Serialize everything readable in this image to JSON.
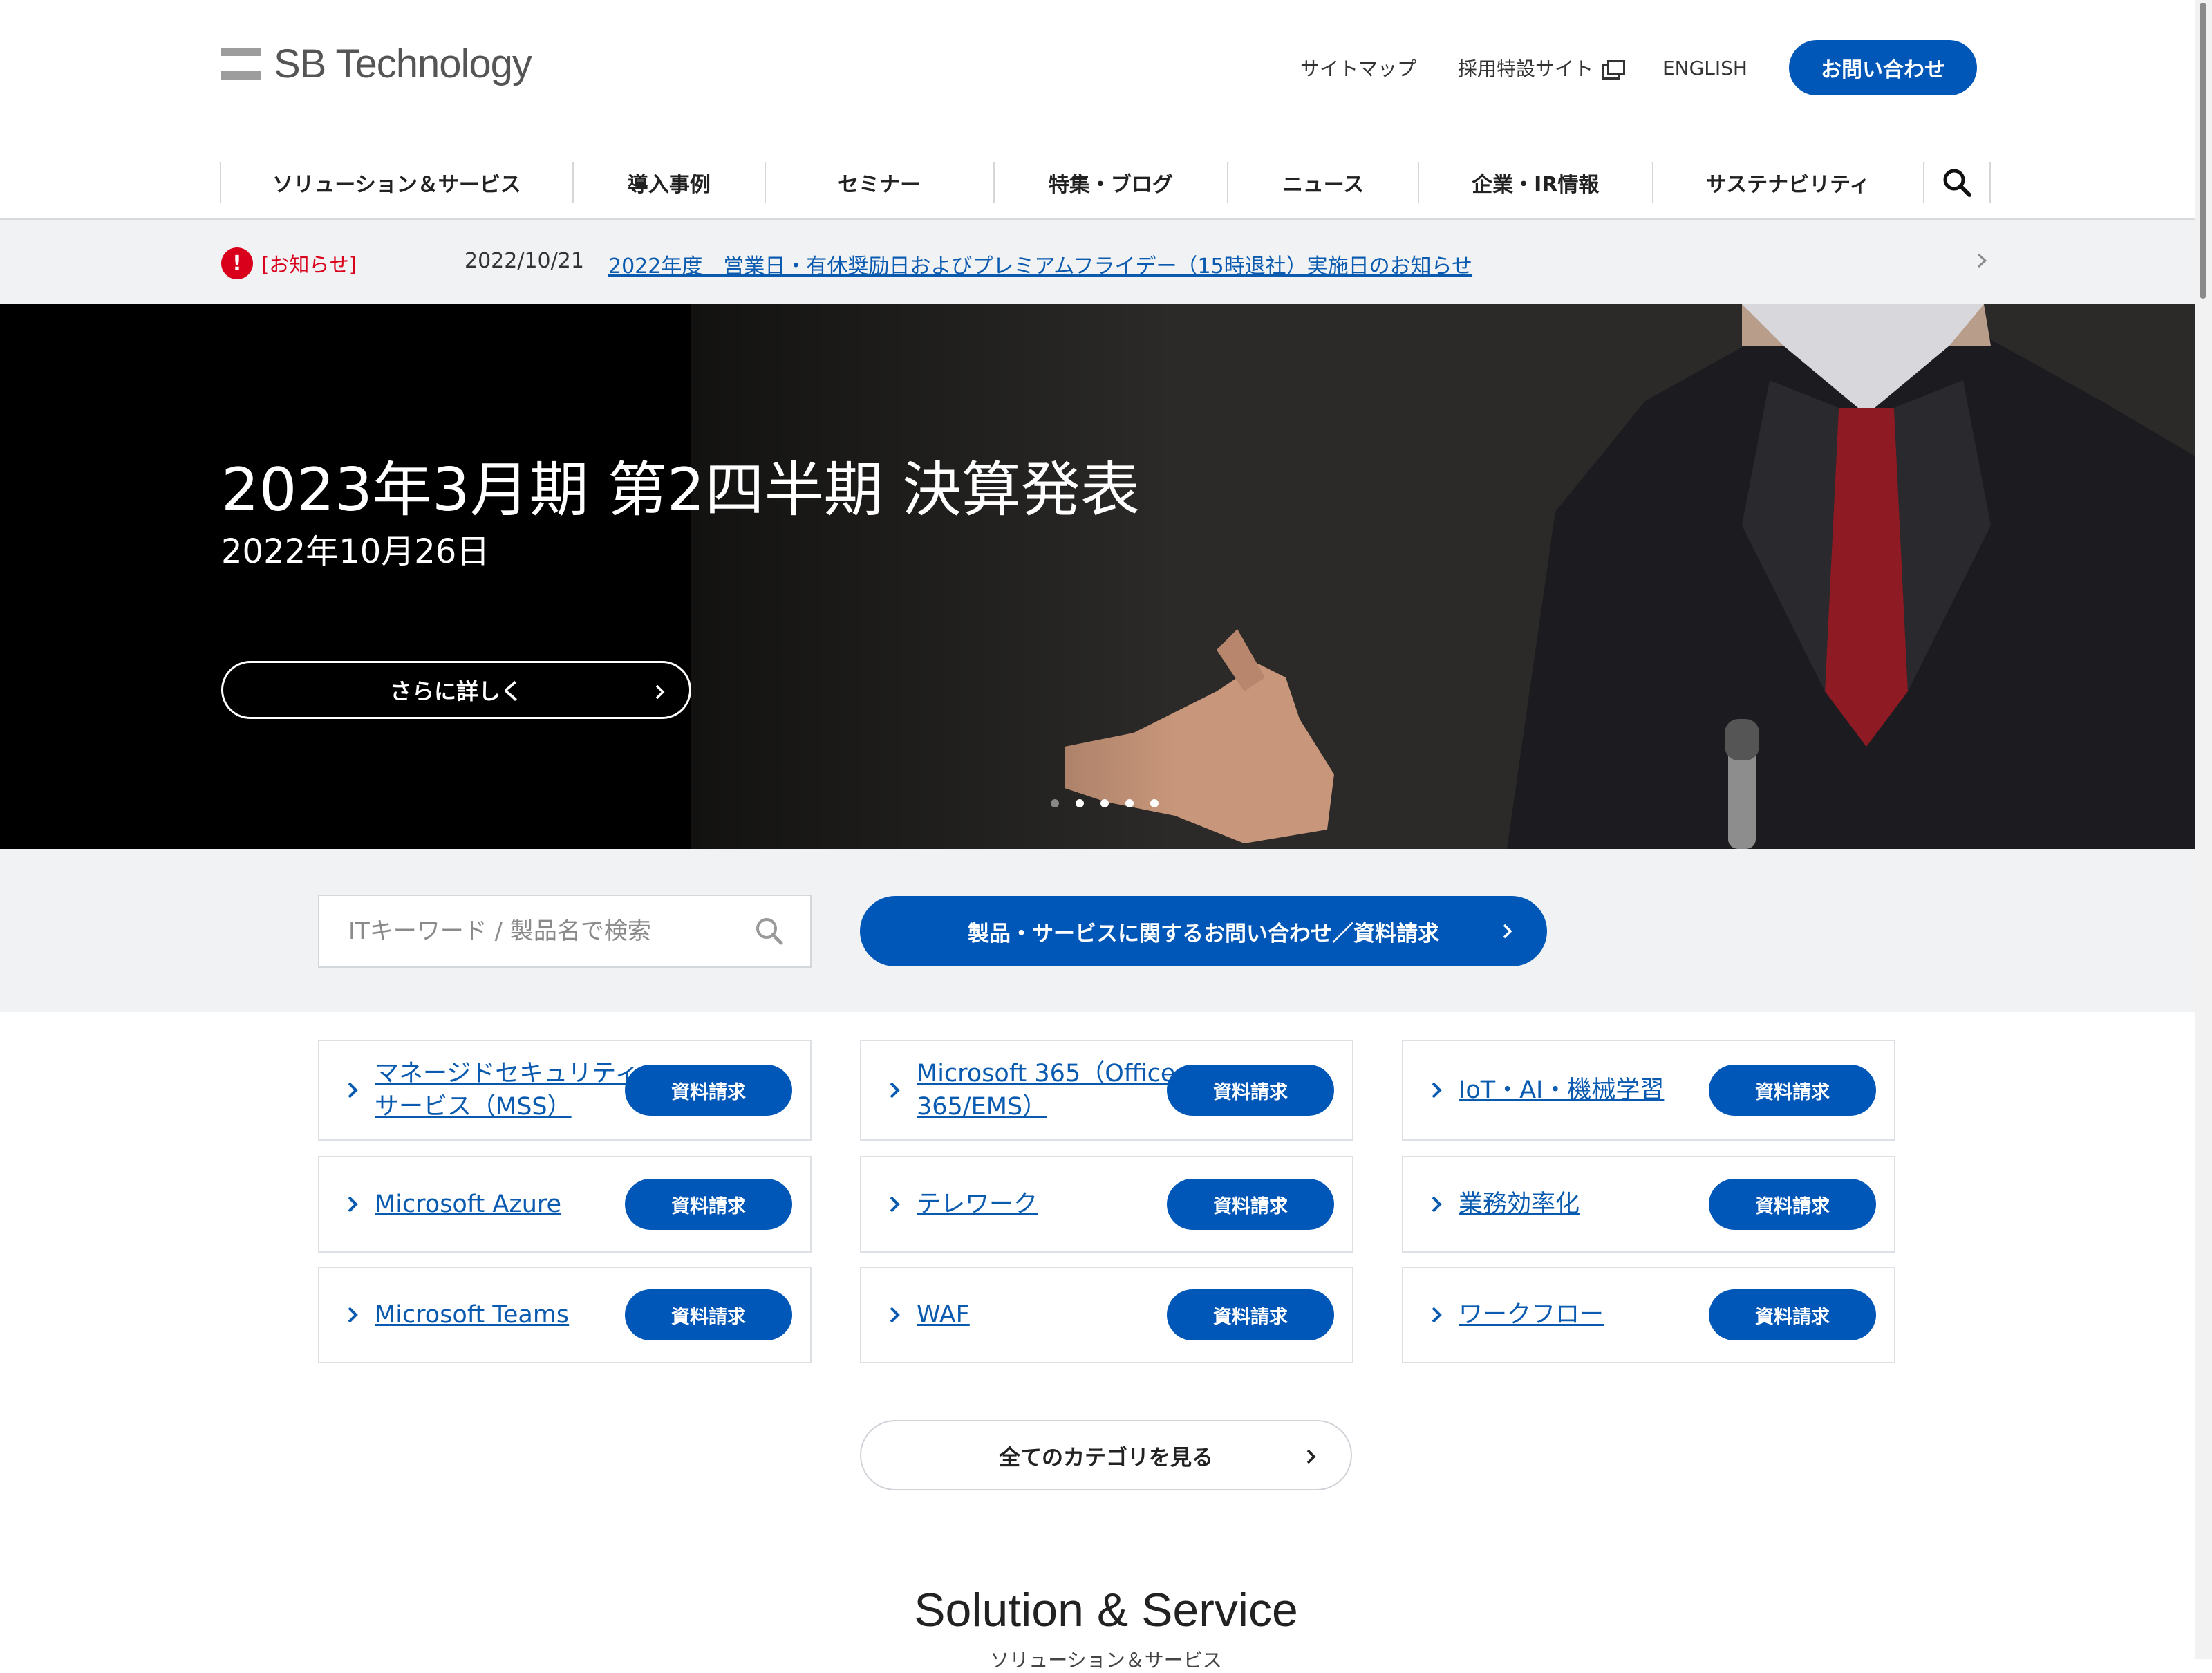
{
  "header": {
    "logo_text": "SB Technology",
    "util": {
      "sitemap": "サイトマップ",
      "recruit": "採用特設サイト",
      "english": "ENGLISH",
      "contact": "お問い合わせ"
    },
    "nav": [
      "ソリューション＆サービス",
      "導入事例",
      "セミナー",
      "特集・ブログ",
      "ニュース",
      "企業・IR情報",
      "サステナビリティ"
    ]
  },
  "notice": {
    "label": "[お知らせ]",
    "date": "2022/10/21",
    "link_text": "2022年度　営業日・有休奨励日およびプレミアムフライデー（15時退社）実施日のお知らせ"
  },
  "hero": {
    "title": "2023年3月期 第2四半期 決算発表",
    "date": "2022年10月26日",
    "button": "さらに詳しく",
    "slides": 5,
    "active_slide": 1
  },
  "search": {
    "placeholder": "ITキーワード / 製品名で検索",
    "inquiry_button": "製品・サービスに関するお問い合わせ／資料請求"
  },
  "categories": [
    {
      "label_lines": [
        "マネージドセキュリティ",
        "サービス（MSS）"
      ],
      "button": "資料請求"
    },
    {
      "label_lines": [
        "Microsoft 365（Office",
        "365/EMS）"
      ],
      "button": "資料請求"
    },
    {
      "label_lines": [
        "IoT・AI・機械学習"
      ],
      "button": "資料請求"
    },
    {
      "label_lines": [
        "Microsoft Azure"
      ],
      "button": "資料請求"
    },
    {
      "label_lines": [
        "テレワーク"
      ],
      "button": "資料請求"
    },
    {
      "label_lines": [
        "業務効率化"
      ],
      "button": "資料請求"
    },
    {
      "label_lines": [
        "Microsoft Teams"
      ],
      "button": "資料請求"
    },
    {
      "label_lines": [
        "WAF"
      ],
      "button": "資料請求"
    },
    {
      "label_lines": [
        "ワークフロー"
      ],
      "button": "資料請求"
    }
  ],
  "all_categories_button": "全てのカテゴリを見る",
  "section": {
    "title": "Solution & Service",
    "subtitle": "ソリューション＆サービス"
  },
  "colors": {
    "primary": "#0057b7",
    "alert": "#d9001b",
    "band": "#f0f2f4"
  }
}
